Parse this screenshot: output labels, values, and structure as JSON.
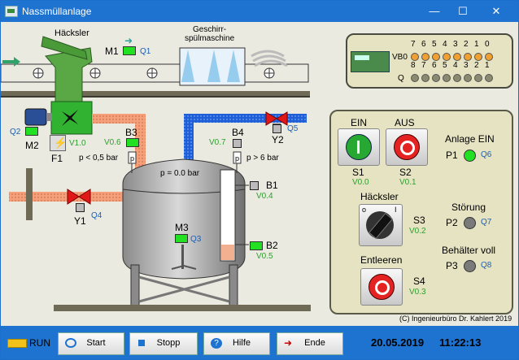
{
  "window": {
    "title": "Nassmüllanlage"
  },
  "plant": {
    "chopper_label": "Häcksler",
    "dishwasher_label": "Geschirr-\nspülmaschine",
    "m1": "M1",
    "q1": "Q1",
    "m2": "M2",
    "q2": "Q2",
    "f1": "F1",
    "v10": "V1.0",
    "b3": "B3",
    "v06": "V0.6",
    "b3_text": "p < 0,5 bar",
    "b4": "B4",
    "v07": "V0.7",
    "b4_text": "p > 6 bar",
    "y2": "Y2",
    "q5": "Q5",
    "y1": "Y1",
    "q4": "Q4",
    "b1": "B1",
    "v04": "V0.4",
    "b2": "B2",
    "v05": "V0.5",
    "m3": "M3",
    "q3": "Q3",
    "pressure": "p =  0.0 bar"
  },
  "plc": {
    "row1_label": "VB0",
    "row1_bits": [
      "7",
      "6",
      "5",
      "4",
      "3",
      "2",
      "1",
      "0"
    ],
    "row2_label": "Q",
    "row2_bits": [
      "8",
      "7",
      "6",
      "5",
      "4",
      "3",
      "2",
      "1"
    ]
  },
  "panel": {
    "ein": "EIN",
    "aus": "AUS",
    "s1": "S1",
    "v00": "V0.0",
    "s2": "S2",
    "v01": "V0.1",
    "anlage_ein": "Anlage EIN",
    "p1": "P1",
    "q6": "Q6",
    "haecksler": "Häcksler",
    "s3": "S3",
    "v02": "V0.2",
    "stoerung": "Störung",
    "p2": "P2",
    "q7": "Q7",
    "behaelter_voll": "Behälter voll",
    "p3": "P3",
    "q8": "Q8",
    "entleeren": "Entleeren",
    "s4": "S4",
    "v03": "V0.3"
  },
  "copyright": "(C) Ingenieurbüro Dr. Kahlert 2019",
  "toolbar": {
    "run_label": "RUN",
    "start_label": "Start",
    "stop_label": "Stopp",
    "help_label": "Hilfe",
    "end_label": "Ende",
    "date": "20.05.2019",
    "time": "11:22:13"
  },
  "colors": {
    "titlebar": "#1e73d1",
    "led_on": "#22e022",
    "pipe_blue": "#1e5fd8",
    "pipe_salmon": "#f5a07a"
  }
}
